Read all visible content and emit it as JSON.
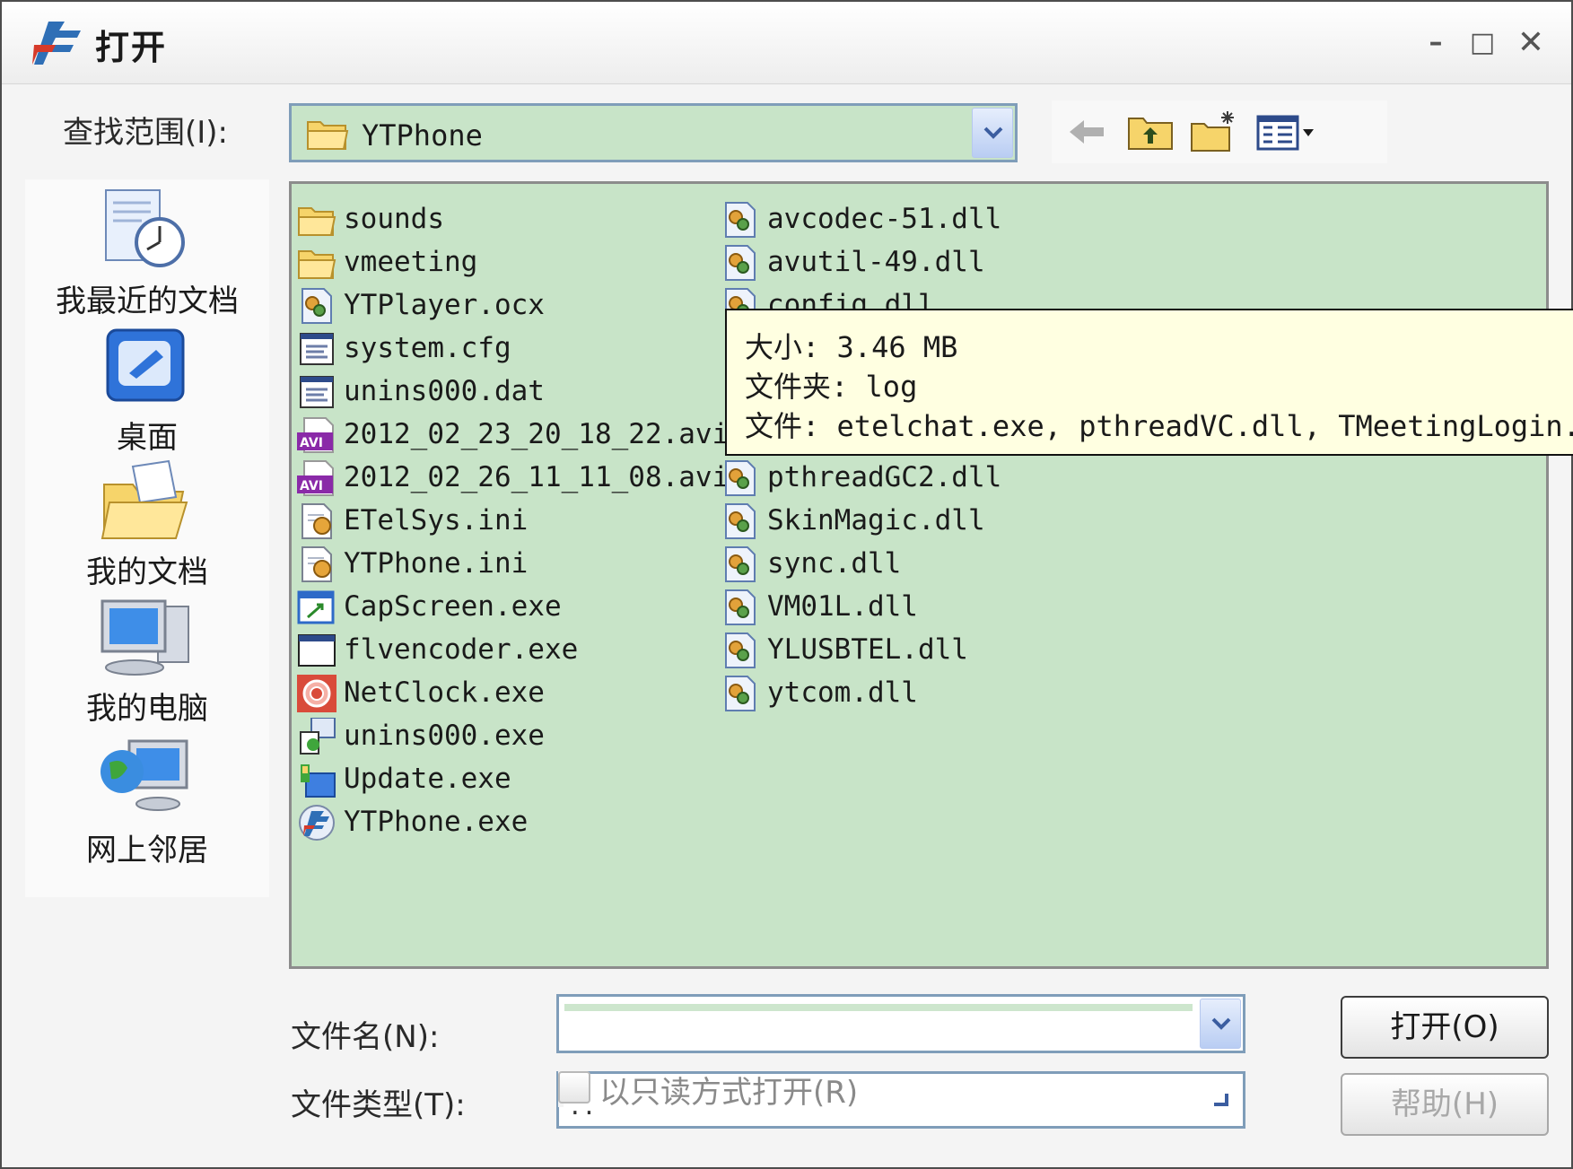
{
  "window": {
    "title": "打开"
  },
  "lookin": {
    "label": "查找范围(I):",
    "value": "YTPhone"
  },
  "places": [
    {
      "label": "我最近的文档"
    },
    {
      "label": "桌面"
    },
    {
      "label": "我的文档"
    },
    {
      "label": "我的电脑"
    },
    {
      "label": "网上邻居"
    }
  ],
  "files_col1": [
    {
      "name": "sounds",
      "icon": "folder-icon"
    },
    {
      "name": "vmeeting",
      "icon": "folder-icon"
    },
    {
      "name": "YTPlayer.ocx",
      "icon": "dll-icon"
    },
    {
      "name": "system.cfg",
      "icon": "config-file-icon"
    },
    {
      "name": "unins000.dat",
      "icon": "config-file-icon"
    },
    {
      "name": "2012_02_23_20_18_22.avi",
      "icon": "avi-icon"
    },
    {
      "name": "2012_02_26_11_11_08.avi",
      "icon": "avi-icon"
    },
    {
      "name": "ETelSys.ini",
      "icon": "ini-icon"
    },
    {
      "name": "YTPhone.ini",
      "icon": "ini-icon"
    },
    {
      "name": "CapScreen.exe",
      "icon": "capture-exe-icon"
    },
    {
      "name": "flvencoder.exe",
      "icon": "window-exe-icon"
    },
    {
      "name": "NetClock.exe",
      "icon": "clock-exe-icon"
    },
    {
      "name": "unins000.exe",
      "icon": "uninstall-exe-icon"
    },
    {
      "name": "Update.exe",
      "icon": "update-exe-icon"
    },
    {
      "name": "YTPhone.exe",
      "icon": "app-exe-icon"
    }
  ],
  "files_col2": [
    {
      "name": "avcodec-51.dll",
      "icon": "dll-icon"
    },
    {
      "name": "avutil-49.dll",
      "icon": "dll-icon"
    },
    {
      "name": "config.dll",
      "icon": "dll-icon"
    },
    {
      "name": "",
      "icon": "dll-icon"
    },
    {
      "name": "",
      "icon": "dll-icon"
    },
    {
      "name": "",
      "icon": "dll-icon"
    },
    {
      "name": "pthreadGC2.dll",
      "icon": "dll-icon"
    },
    {
      "name": "SkinMagic.dll",
      "icon": "dll-icon"
    },
    {
      "name": "sync.dll",
      "icon": "dll-icon"
    },
    {
      "name": "VM01L.dll",
      "icon": "dll-icon"
    },
    {
      "name": "YLUSBTEL.dll",
      "icon": "dll-icon"
    },
    {
      "name": "ytcom.dll",
      "icon": "dll-icon"
    }
  ],
  "tooltip": {
    "size": "大小: 3.46 MB",
    "folder": "文件夹: log",
    "files": "文件: etelchat.exe, pthreadVC.dll, TMeetingLogin.e"
  },
  "form": {
    "filename_label": "文件名(N):",
    "filename_value": "",
    "filetype_label": "文件类型(T):",
    "filetype_value": "..",
    "readonly_label": "以只读方式打开(R)"
  },
  "buttons": {
    "open": "打开(O)",
    "help": "帮助(H)"
  },
  "colors": {
    "list_bg": "#c8e4c8",
    "tooltip_bg": "#ffffe1",
    "border_blue": "#7f9db9"
  }
}
